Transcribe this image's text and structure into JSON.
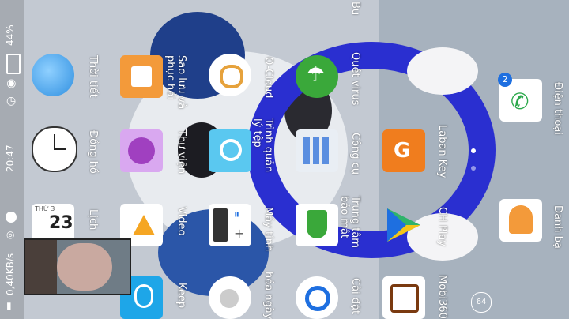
{
  "status": {
    "battery": "44%",
    "time": "20:47",
    "speed": "0,40KB/s"
  },
  "apps": [
    {
      "id": "weather",
      "label": "Thời tiết"
    },
    {
      "id": "clock",
      "label": "Đồng hồ"
    },
    {
      "id": "calendar",
      "label": "Lịch",
      "day_name": "THỨ 3",
      "day_num": "23"
    },
    {
      "id": "backup",
      "label": "Sao lưu và phục hồi"
    },
    {
      "id": "gallery",
      "label": "Thư viện"
    },
    {
      "id": "video",
      "label": "Video"
    },
    {
      "id": "keep",
      "label": "Keep"
    },
    {
      "id": "ocloud",
      "label": "O-Cloud"
    },
    {
      "id": "filemanager",
      "label": "Trình quản lý tệp"
    },
    {
      "id": "calculator",
      "label": "Máy tính"
    },
    {
      "id": "daily",
      "label": "hóa ngày"
    },
    {
      "id": "antivirus",
      "label": "Quét virus"
    },
    {
      "id": "tools",
      "label": "Công cụ"
    },
    {
      "id": "security",
      "label": "Trung tâm bảo mật"
    },
    {
      "id": "settings",
      "label": "Cài đặt"
    },
    {
      "id": "bu",
      "label": "Bu"
    },
    {
      "id": "labankey",
      "label": "Laban Key"
    },
    {
      "id": "chplay",
      "label": "CH Play"
    },
    {
      "id": "mobi360",
      "label": "Mobi360"
    },
    {
      "id": "phone",
      "label": "Điện thoại",
      "badge": "2"
    },
    {
      "id": "contacts",
      "label": "Danh bạ"
    }
  ],
  "dock_page_indicator": "64",
  "colors": {
    "blue_ring": "#2a2fd0",
    "backup_orange": "#f39a3a",
    "antivirus_green": "#3aa83a",
    "laban_orange": "#f07d1e",
    "phone_green": "#2aa84a"
  }
}
